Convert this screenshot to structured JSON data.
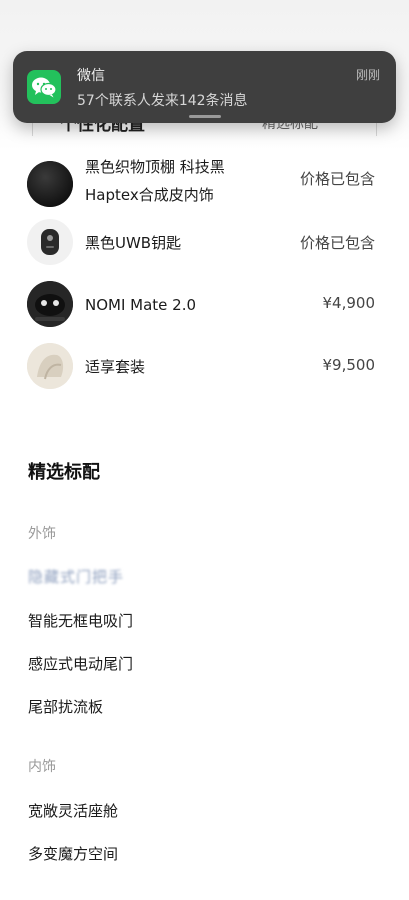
{
  "notification": {
    "app_name": "微信",
    "message": "57个联系人发来142条消息",
    "time": "刚刚",
    "app_icon": "wechat-icon"
  },
  "hidden_header": {
    "left_text": "个性化配置",
    "right_text": "精选标配"
  },
  "items": [
    {
      "name_line1": "黑色织物顶棚 科技黑",
      "name_line2": "Haptex合成皮内饰",
      "price": "价格已包含"
    },
    {
      "name_line1": "黑色UWB钥匙",
      "price": "价格已包含"
    },
    {
      "name_line1": "NOMI Mate 2.0",
      "price": "¥4,900"
    },
    {
      "name_line1": "适享套装",
      "price": "¥9,500"
    }
  ],
  "standard": {
    "title": "精选标配",
    "groups": [
      {
        "label": "外饰",
        "features": [
          "隐藏式门把手",
          "智能无框电吸门",
          "感应式电动尾门",
          "尾部扰流板"
        ]
      },
      {
        "label": "内饰",
        "features": [
          "宽敞灵活座舱",
          "多变魔方空间"
        ]
      }
    ]
  }
}
